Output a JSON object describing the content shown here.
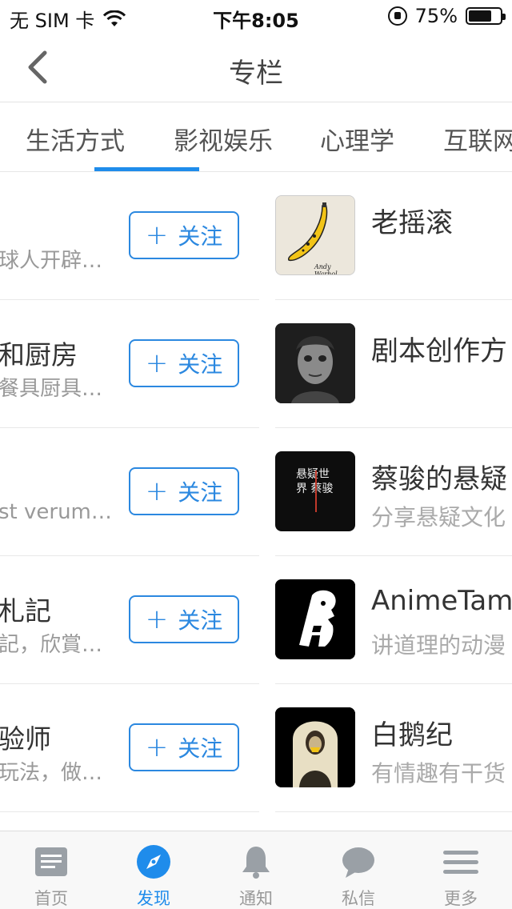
{
  "status": {
    "carrier": "无 SIM 卡",
    "time": "下午8:05",
    "battery": "75%",
    "battery_level": 0.75
  },
  "navbar": {
    "title": "专栏",
    "back_icon": "chevron-left-icon"
  },
  "tabs": [
    {
      "label": "生活方式"
    },
    {
      "label": "影视娱乐",
      "active": true
    },
    {
      "label": "心理学"
    },
    {
      "label": "互联网"
    }
  ],
  "follow_label": "关注",
  "left_items": [
    {
      "title": "",
      "desc": "球人开辟…"
    },
    {
      "title": "和厨房",
      "desc": "餐具厨具…"
    },
    {
      "title": "",
      "desc": "st verum…"
    },
    {
      "title": "札記",
      "desc": "記，欣賞…"
    },
    {
      "title": "验师",
      "desc": "玩法，做…"
    }
  ],
  "right_items": [
    {
      "title": "老摇滚",
      "desc": "",
      "thumb_text": "Andy Warhol"
    },
    {
      "title": "剧本创作方",
      "desc": ""
    },
    {
      "title": "蔡骏的悬疑",
      "desc": "分享悬疑文化",
      "thumb_text": "悬疑世界 蔡骏"
    },
    {
      "title": "AnimeTama",
      "desc": "讲道理的动漫"
    },
    {
      "title": "白鹅纪",
      "desc": "有情趣有干货"
    }
  ],
  "tabbar": [
    {
      "label": "首页",
      "icon": "home-icon"
    },
    {
      "label": "发现",
      "icon": "compass-icon",
      "active": true
    },
    {
      "label": "通知",
      "icon": "bell-icon"
    },
    {
      "label": "私信",
      "icon": "message-icon"
    },
    {
      "label": "更多",
      "icon": "menu-icon"
    }
  ],
  "colors": {
    "accent": "#1f8ceb",
    "follow_border": "#2b88e0",
    "muted": "#999999"
  }
}
